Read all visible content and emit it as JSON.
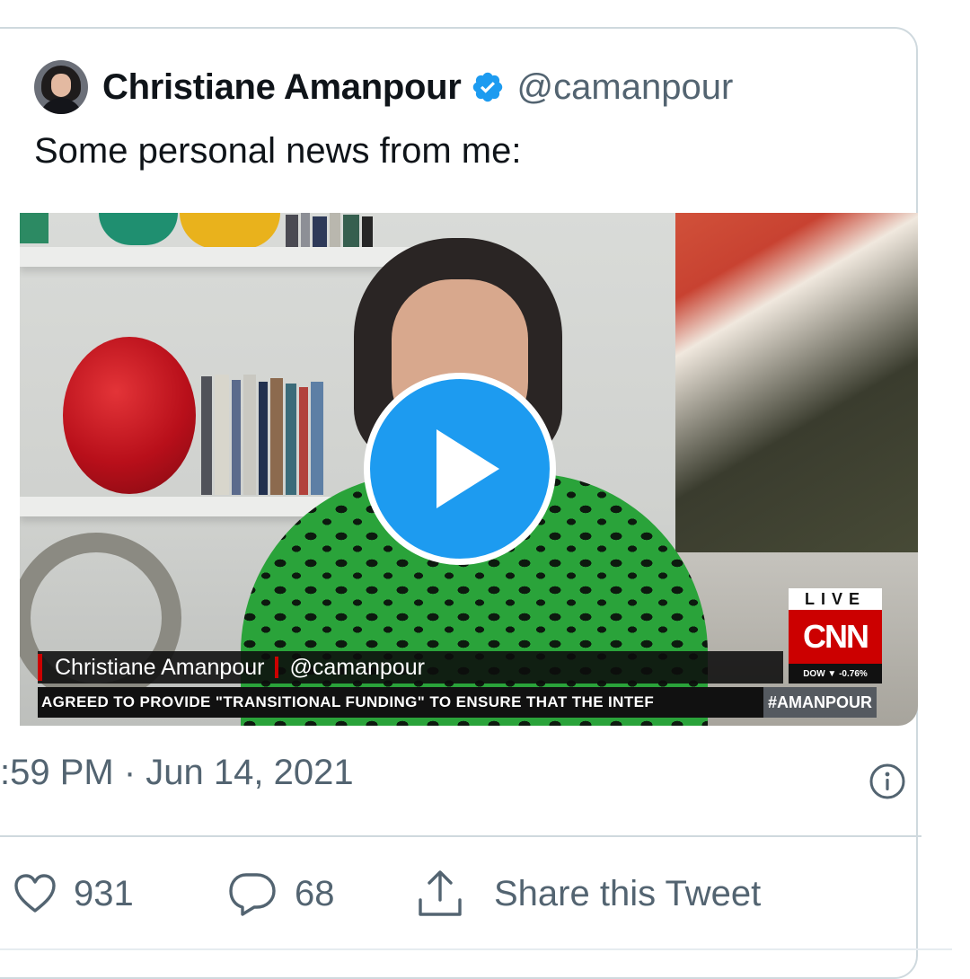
{
  "tweet": {
    "author_name": "Christiane Amanpour",
    "handle": "@camanpour",
    "text": "Some personal news from me:",
    "timestamp": ":59 PM · Jun 14, 2021"
  },
  "video": {
    "lower_third_name": "Christiane Amanpour",
    "lower_third_handle": "@camanpour",
    "ticker": "AGREED TO PROVIDE \"TRANSITIONAL FUNDING\" TO ENSURE THAT THE INTEF",
    "hashtag": "#AMANPOUR",
    "live_label": "LIVE",
    "network_logo": "CNN",
    "market": "DOW ▼ -0.76%"
  },
  "actions": {
    "likes": "931",
    "replies": "68",
    "share_label": "Share this Tweet"
  },
  "icons": {
    "verified": "verified-badge-icon",
    "play": "play-icon",
    "info": "info-icon",
    "like": "heart-icon",
    "reply": "reply-icon",
    "share": "share-icon"
  },
  "colors": {
    "accent": "#1d9bf0",
    "secondary_text": "#536471",
    "border": "#cfd9de",
    "cnn_red": "#cc0000"
  }
}
